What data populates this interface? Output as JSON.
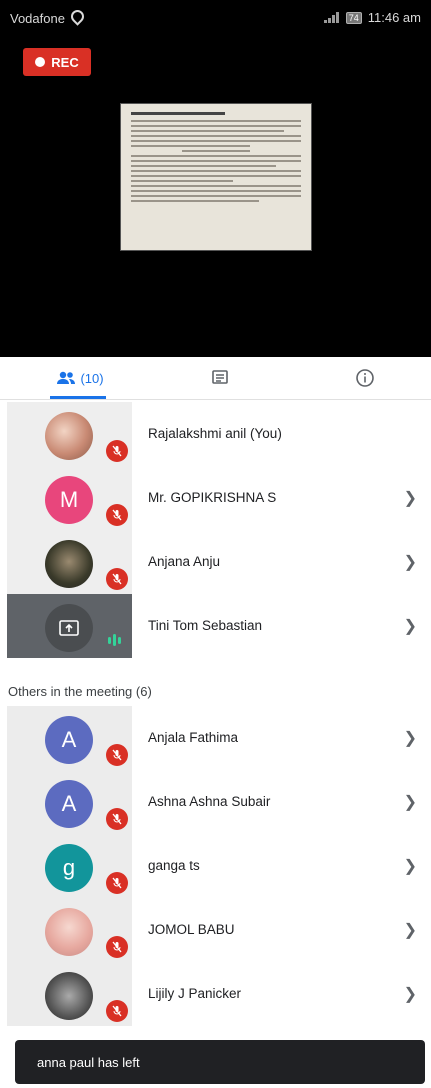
{
  "status_bar": {
    "carrier": "Vodafone",
    "battery": "74",
    "time": "11:46 am"
  },
  "recording": {
    "label": "REC"
  },
  "tabs": {
    "people_count": "(10)"
  },
  "participants": [
    {
      "name": "Rajalakshmi anil (You)",
      "avatar": "photo",
      "muted": true,
      "chevron": false
    },
    {
      "name": "Mr. GOPIKRISHNA S",
      "avatar": "M",
      "avatar_color": "#e8467c",
      "muted": true,
      "chevron": true
    },
    {
      "name": "Anjana Anju",
      "avatar": "photo",
      "muted": true,
      "chevron": true
    },
    {
      "name": "Tini Tom Sebastian",
      "avatar": "present-icon",
      "presenting": true,
      "chevron": true
    }
  ],
  "others_title": "Others in the meeting (6)",
  "others": [
    {
      "name": "Anjala Fathima",
      "avatar": "A",
      "avatar_color": "#5c6bc0",
      "muted": true
    },
    {
      "name": "Ashna Ashna Subair",
      "avatar": "A",
      "avatar_color": "#5c6bc0",
      "muted": true
    },
    {
      "name": "ganga ts",
      "avatar": "g",
      "avatar_color": "#12959b",
      "muted": true
    },
    {
      "name": "JOMOL BABU",
      "avatar": "photo",
      "muted": true
    },
    {
      "name": "Lijily J Panicker",
      "avatar": "photo",
      "muted": true
    }
  ],
  "toast": "anna paul has left",
  "colors": {
    "accent": "#1a73e8",
    "mute_red": "#d93025"
  }
}
